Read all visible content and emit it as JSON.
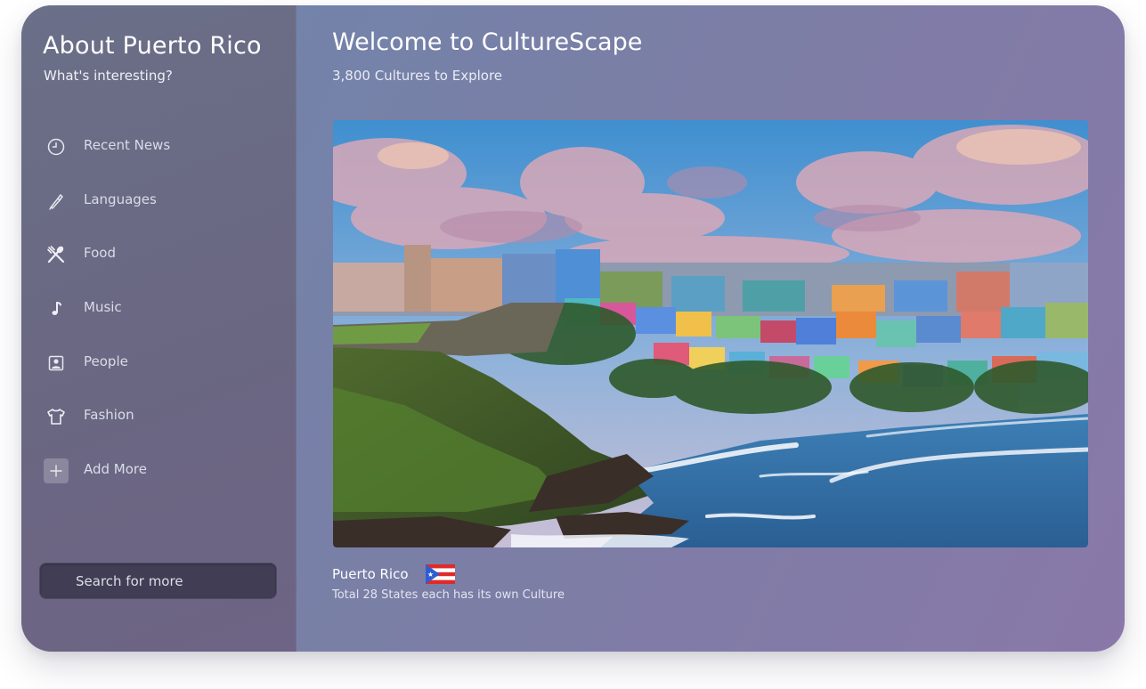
{
  "sidebar": {
    "title": "About Puerto Rico",
    "subtitle": "What's interesting?",
    "items": [
      {
        "label": "Recent News",
        "icon": "clock-icon"
      },
      {
        "label": "Languages",
        "icon": "pen-icon"
      },
      {
        "label": "Food",
        "icon": "utensils-icon"
      },
      {
        "label": "Music",
        "icon": "music-note-icon"
      },
      {
        "label": "People",
        "icon": "person-portrait-icon"
      },
      {
        "label": "Fashion",
        "icon": "shirt-icon"
      },
      {
        "label": "Add More",
        "icon": "plus-icon"
      }
    ],
    "search": {
      "placeholder": "Search for more"
    }
  },
  "main": {
    "title": "Welcome to CultureScape",
    "subtitle": "3,800 Cultures to Explore",
    "hero": {
      "image": "Puerto Rico coastline with colorful hillside town and ocean waves"
    },
    "caption": {
      "title": "Puerto Rico",
      "flag_icon": "puerto-rico-flag-icon",
      "subtitle": "Total 28 States each has its own Culture"
    }
  },
  "colors": {
    "background_start": "#6e86ad",
    "background_end": "#8978a8",
    "sidebar": "#6a6782",
    "search_field": "#403d55",
    "text_primary": "#ffffff"
  }
}
